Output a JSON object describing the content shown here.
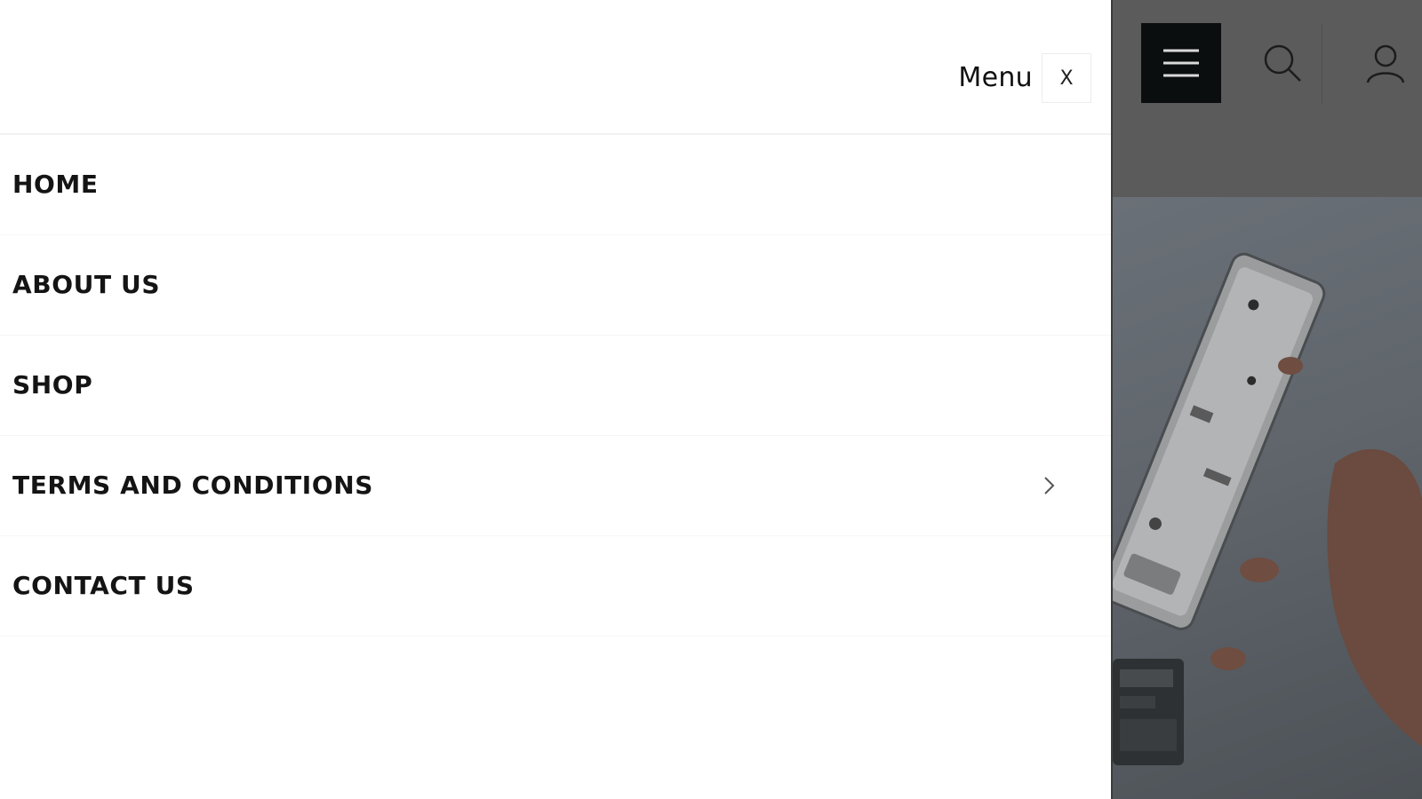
{
  "drawer": {
    "title": "Menu",
    "close_label": "X",
    "items": [
      {
        "label": "HOME",
        "has_submenu": false
      },
      {
        "label": "ABOUT US",
        "has_submenu": false
      },
      {
        "label": "SHOP",
        "has_submenu": false
      },
      {
        "label": "TERMS AND CONDITIONS",
        "has_submenu": true
      },
      {
        "label": "CONTACT US",
        "has_submenu": false
      }
    ]
  },
  "header_icons": [
    "hamburger-icon",
    "search-icon",
    "user-icon"
  ],
  "hero": {
    "image": "phone-repair-photo"
  },
  "colors": {
    "overlay": "#565656",
    "hamburger_bg": "#0b0e0f",
    "text": "#111111"
  }
}
